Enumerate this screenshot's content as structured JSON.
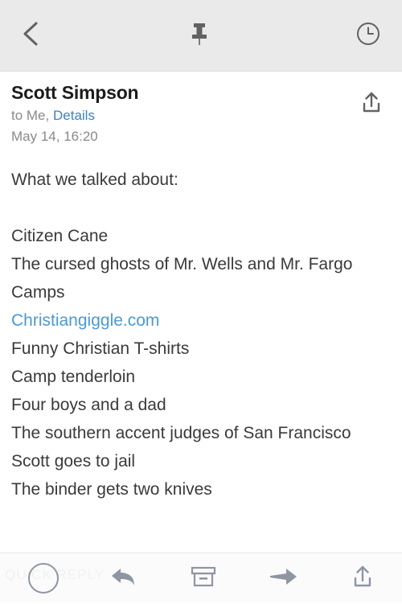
{
  "topbar": {
    "back_label": "Back",
    "pin_label": "Pin",
    "clock_label": "Snooze"
  },
  "message_header": {
    "sender": "Scott Simpson",
    "recipient_prefix": "to Me,",
    "details_label": "Details",
    "date": "May 14, 16:20",
    "share_label": "Share"
  },
  "body": {
    "lines": [
      {
        "text": "What we talked about:",
        "link": false
      },
      {
        "text": "",
        "link": false
      },
      {
        "text": "Citizen Cane",
        "link": false
      },
      {
        "text": "The cursed ghosts of Mr. Wells and Mr. Fargo",
        "link": false
      },
      {
        "text": "Camps",
        "link": false
      },
      {
        "text": "Christiangiggle.com",
        "link": true
      },
      {
        "text": "Funny Christian T-shirts",
        "link": false
      },
      {
        "text": "Camp tenderloin",
        "link": false
      },
      {
        "text": "Four boys and a dad",
        "link": false
      },
      {
        "text": "The southern accent judges of San Francisco",
        "link": false
      },
      {
        "text": "Scott goes to jail",
        "link": false
      },
      {
        "text": "The binder gets two knives",
        "link": false
      }
    ]
  },
  "bottombar": {
    "quick_reply_label": "QUICK REPLY",
    "reply_label": "Reply",
    "archive_label": "Archive",
    "forward_label": "Forward",
    "share_label": "Share"
  },
  "colors": {
    "topbar_bg": "#eaeaea",
    "icon_gray": "#626262",
    "link_blue": "#3b82c4",
    "body_link_blue": "#4a9ad4",
    "body_text": "#3a3a3a",
    "meta_text": "#8a8a8a",
    "bottom_icon": "#8e96a3"
  }
}
